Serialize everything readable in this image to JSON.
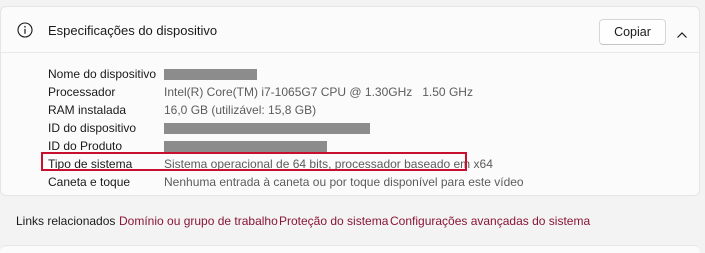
{
  "section": {
    "title": "Especificações do dispositivo",
    "copy_label": "Copiar",
    "info_icon": "info-icon",
    "collapse_icon": "chevron-up-icon"
  },
  "specs": [
    {
      "label": "Nome do dispositivo",
      "value": null,
      "redacted": true
    },
    {
      "label": "Processador",
      "value": "Intel(R) Core(TM) i7-1065G7 CPU @ 1.30GHz   1.50 GHz",
      "redacted": false
    },
    {
      "label": "RAM instalada",
      "value": "16,0 GB (utilizável: 15,8 GB)",
      "redacted": false
    },
    {
      "label": "ID do dispositivo",
      "value": null,
      "redacted": true
    },
    {
      "label": "ID do Produto",
      "value": null,
      "redacted": true
    },
    {
      "label": "Tipo de sistema",
      "value": "Sistema operacional de 64 bits, processador baseado em x64",
      "redacted": false,
      "highlighted": true
    },
    {
      "label": "Caneta e toque",
      "value": "Nenhuma entrada à caneta ou por toque disponível para este vídeo",
      "redacted": false
    }
  ],
  "related_links": {
    "label": "Links relacionados",
    "items": [
      "Domínio ou grupo de trabalho",
      "Proteção do sistema",
      "Configurações avançadas do sistema"
    ]
  },
  "colors": {
    "link": "#8a1538",
    "highlight_border": "#c8102e",
    "redaction": "#8c8c8c"
  }
}
